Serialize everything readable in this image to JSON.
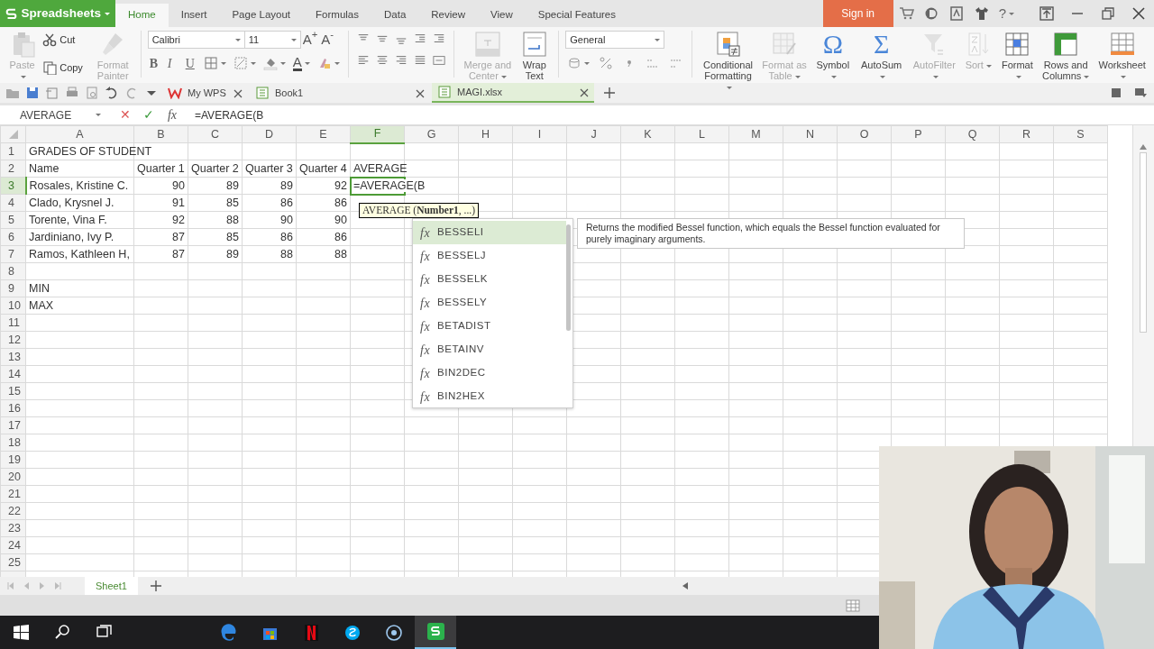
{
  "app_menu": {
    "label": "Spreadsheets"
  },
  "menu_tabs": [
    {
      "label": "Home",
      "selected": true
    },
    {
      "label": "Insert",
      "selected": false
    },
    {
      "label": "Page Layout",
      "selected": false
    },
    {
      "label": "Formulas",
      "selected": false
    },
    {
      "label": "Data",
      "selected": false
    },
    {
      "label": "Review",
      "selected": false
    },
    {
      "label": "View",
      "selected": false
    },
    {
      "label": "Special Features",
      "selected": false
    }
  ],
  "sign_in": "Sign in",
  "help": "?",
  "ribbon": {
    "clipboard": [
      {
        "label": "Paste",
        "kind": "large",
        "disabled": true,
        "menu": true
      },
      {
        "label": "Cut",
        "kind": "small",
        "disabled": false,
        "menu": false
      },
      {
        "label": "Copy",
        "kind": "small",
        "disabled": false,
        "menu": false
      },
      {
        "label": "Format Painter",
        "kind": "large",
        "disabled": true,
        "menu": false
      }
    ],
    "font": "Calibri",
    "font_size": "11",
    "size_buttons": [
      "A$^{+}$",
      "A$^{-}$"
    ],
    "font_styles": [
      "B",
      "I",
      "U"
    ],
    "font_color": "A",
    "alignment_buttons": [
      {
        "label": "Merge and Center",
        "disabled": true,
        "menu": true
      },
      {
        "label": "Wrap Text",
        "disabled": false,
        "menu": false
      }
    ],
    "number_format": "General",
    "cells_buttons": [
      {
        "label": "Conditional Formatting",
        "disabled": false,
        "menu": true
      },
      {
        "label": "Format as Table",
        "disabled": true,
        "menu": true
      },
      {
        "label": "Symbol",
        "glyph": "Ω",
        "disabled": false,
        "menu": true
      },
      {
        "label": "AutoSum",
        "glyph": "Σ",
        "disabled": false,
        "menu": true
      },
      {
        "label": "AutoFilter",
        "disabled": true,
        "menu": true
      },
      {
        "label": "Sort",
        "disabled": true,
        "menu": true
      },
      {
        "label": "Format",
        "disabled": false,
        "menu": true
      },
      {
        "label": "Rows and Columns",
        "disabled": false,
        "menu": true
      },
      {
        "label": "Worksheet",
        "disabled": false,
        "menu": true
      }
    ]
  },
  "doc_tabs": [
    {
      "label": "My WPS",
      "selected": false
    },
    {
      "label": "Book1",
      "selected": false
    },
    {
      "label": "MAGI.xlsx",
      "selected": true
    }
  ],
  "formula_bar": {
    "name_box": "AVERAGE",
    "buttons": [
      "✕",
      "✓",
      "fx"
    ],
    "formula": "=AVERAGE(B"
  },
  "columns": [
    {
      "label": "A",
      "selected": false
    },
    {
      "label": "B",
      "selected": false
    },
    {
      "label": "C",
      "selected": false
    },
    {
      "label": "D",
      "selected": false
    },
    {
      "label": "E",
      "selected": false
    },
    {
      "label": "F",
      "selected": true
    },
    {
      "label": "G",
      "selected": false
    },
    {
      "label": "H",
      "selected": false
    },
    {
      "label": "I",
      "selected": false
    },
    {
      "label": "J",
      "selected": false
    },
    {
      "label": "K",
      "selected": false
    },
    {
      "label": "L",
      "selected": false
    },
    {
      "label": "M",
      "selected": false
    },
    {
      "label": "N",
      "selected": false
    },
    {
      "label": "O",
      "selected": false
    },
    {
      "label": "P",
      "selected": false
    },
    {
      "label": "Q",
      "selected": false
    },
    {
      "label": "R",
      "selected": false
    },
    {
      "label": "S",
      "selected": false
    }
  ],
  "rows": [
    {
      "label": "1",
      "selected": false,
      "cells": [
        {
          "kind": "text",
          "text": "GRADES OF STUDENT"
        }
      ]
    },
    {
      "label": "2",
      "selected": false,
      "cells": [
        {
          "kind": "text",
          "text": "Name"
        },
        {
          "kind": "text",
          "text": "Quarter 1"
        },
        {
          "kind": "text",
          "text": "Quarter 2"
        },
        {
          "kind": "text",
          "text": "Quarter 3"
        },
        {
          "kind": "text",
          "text": "Quarter 4"
        },
        {
          "kind": "text",
          "text": "AVERAGE"
        }
      ]
    },
    {
      "label": "3",
      "selected": true,
      "cells": [
        {
          "kind": "text",
          "text": "Rosales, Kristine C."
        },
        {
          "kind": "number",
          "text": "90"
        },
        {
          "kind": "number",
          "text": "89"
        },
        {
          "kind": "number",
          "text": "89"
        },
        {
          "kind": "number",
          "text": "92"
        },
        {
          "kind": "editing",
          "text": "=AVERAGE(B"
        }
      ]
    },
    {
      "label": "4",
      "selected": false,
      "cells": [
        {
          "kind": "text",
          "text": "Clado, Krysnel J."
        },
        {
          "kind": "number",
          "text": "91"
        },
        {
          "kind": "number",
          "text": "85"
        },
        {
          "kind": "number",
          "text": "86"
        },
        {
          "kind": "number",
          "text": "86"
        }
      ]
    },
    {
      "label": "5",
      "selected": false,
      "cells": [
        {
          "kind": "text",
          "text": "Torente, Vina F."
        },
        {
          "kind": "number",
          "text": "92"
        },
        {
          "kind": "number",
          "text": "88"
        },
        {
          "kind": "number",
          "text": "90"
        },
        {
          "kind": "number",
          "text": "90"
        }
      ]
    },
    {
      "label": "6",
      "selected": false,
      "cells": [
        {
          "kind": "text",
          "text": "Jardiniano, Ivy P."
        },
        {
          "kind": "number",
          "text": "87"
        },
        {
          "kind": "number",
          "text": "85"
        },
        {
          "kind": "number",
          "text": "86"
        },
        {
          "kind": "number",
          "text": "86"
        }
      ]
    },
    {
      "label": "7",
      "selected": false,
      "cells": [
        {
          "kind": "text",
          "text": "Ramos, Kathleen H,"
        },
        {
          "kind": "number",
          "text": "87"
        },
        {
          "kind": "number",
          "text": "89"
        },
        {
          "kind": "number",
          "text": "88"
        },
        {
          "kind": "number",
          "text": "88"
        }
      ]
    },
    {
      "label": "8",
      "selected": false,
      "cells": []
    },
    {
      "label": "9",
      "selected": false,
      "cells": [
        {
          "kind": "text",
          "text": "MIN"
        }
      ]
    },
    {
      "label": "10",
      "selected": false,
      "cells": [
        {
          "kind": "text",
          "text": "MAX"
        }
      ]
    },
    {
      "label": "11",
      "selected": false,
      "cells": []
    },
    {
      "label": "12",
      "selected": false,
      "cells": []
    },
    {
      "label": "13",
      "selected": false,
      "cells": []
    },
    {
      "label": "14",
      "selected": false,
      "cells": []
    },
    {
      "label": "15",
      "selected": false,
      "cells": []
    },
    {
      "label": "16",
      "selected": false,
      "cells": []
    },
    {
      "label": "17",
      "selected": false,
      "cells": []
    },
    {
      "label": "18",
      "selected": false,
      "cells": []
    },
    {
      "label": "19",
      "selected": false,
      "cells": []
    },
    {
      "label": "20",
      "selected": false,
      "cells": []
    },
    {
      "label": "21",
      "selected": false,
      "cells": []
    },
    {
      "label": "22",
      "selected": false,
      "cells": []
    },
    {
      "label": "23",
      "selected": false,
      "cells": []
    },
    {
      "label": "24",
      "selected": false,
      "cells": []
    },
    {
      "label": "25",
      "selected": false,
      "cells": []
    }
  ],
  "tooltip": "AVERAGE (**Number1**, ...)",
  "autocomplete": [
    {
      "glyph": "fx",
      "name": "BESSELI",
      "selected": true
    },
    {
      "glyph": "fx",
      "name": "BESSELJ",
      "selected": false
    },
    {
      "glyph": "fx",
      "name": "BESSELK",
      "selected": false
    },
    {
      "glyph": "fx",
      "name": "BESSELY",
      "selected": false
    },
    {
      "glyph": "fx",
      "name": "BETADIST",
      "selected": false
    },
    {
      "glyph": "fx",
      "name": "BETAINV",
      "selected": false
    },
    {
      "glyph": "fx",
      "name": "BIN2DEC",
      "selected": false
    },
    {
      "glyph": "fx",
      "name": "BIN2HEX",
      "selected": false
    }
  ],
  "function_description": "Returns the modified Bessel function, which equals the Bessel function evaluated for purely imaginary arguments.",
  "sheet_tabs": [
    {
      "label": "Sheet1",
      "selected": true
    }
  ]
}
